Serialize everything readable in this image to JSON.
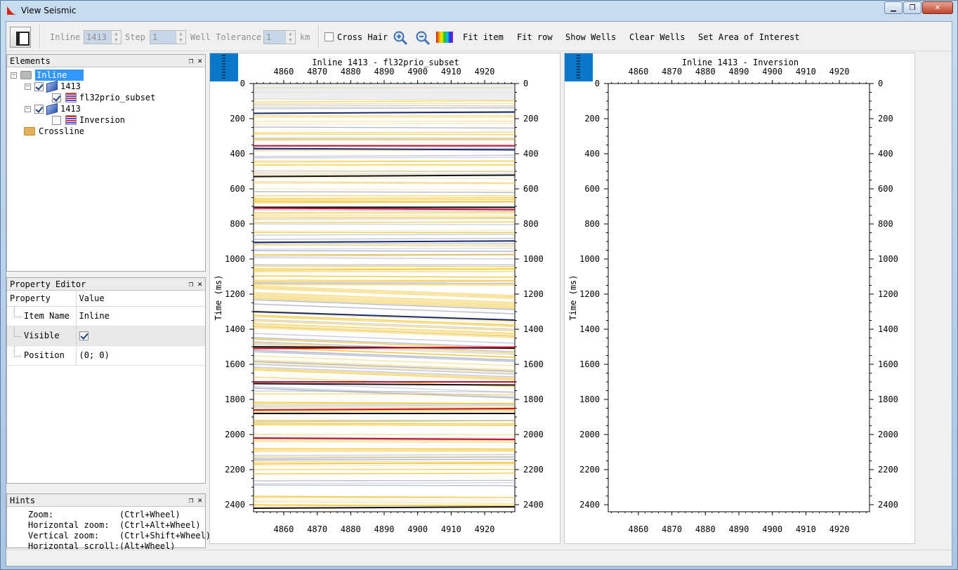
{
  "window": {
    "title": "View Seismic",
    "minimize": "▁",
    "maximize": "❐",
    "close": "✕"
  },
  "toolbar": {
    "inline_label": "Inline",
    "inline_value": "1413",
    "step_label": "Step",
    "step_value": "1",
    "well_tolerance_label": "Well Tolerance",
    "well_tolerance_value": "1",
    "unit": "km",
    "cross_hair_label": "Cross Hair",
    "cross_hair_checked": false,
    "zoom_in_icon": "zoom-in-icon",
    "zoom_out_icon": "zoom-out-icon",
    "palette_icon": "color-palette-icon",
    "fit_item": "Fit item",
    "fit_row": "Fit row",
    "show_wells": "Show Wells",
    "clear_wells": "Clear Wells",
    "set_aoi": "Set Area of Interest"
  },
  "elements_panel": {
    "title": "Elements",
    "tree": [
      {
        "label": "Inline",
        "selected": true
      },
      {
        "label": "1413",
        "checked": true
      },
      {
        "label": "fl32prio_subset",
        "checked": true
      },
      {
        "label": "1413",
        "checked": true
      },
      {
        "label": "Inversion",
        "checked": false
      },
      {
        "label": "Crossline"
      }
    ]
  },
  "property_panel": {
    "title": "Property Editor",
    "col_property": "Property",
    "col_value": "Value",
    "rows": [
      {
        "name": "Item Name",
        "value": "Inline"
      },
      {
        "name": "Visible",
        "value": ""
      },
      {
        "name": "Position",
        "value": "(0; 0)"
      }
    ]
  },
  "hints_panel": {
    "title": "Hints",
    "lines": [
      "Zoom:             (Ctrl+Wheel)",
      "Horizontal zoom:  (Ctrl+Alt+Wheel)",
      "Vertical zoom:    (Ctrl+Shift+Wheel)",
      "Horizontal scroll:(Alt+Wheel)"
    ]
  },
  "plots": [
    {
      "title": "Inline 1413 - fl32prio_subset",
      "ylabel": "Time (ms)",
      "filled": true
    },
    {
      "title": "Inline 1413 - Inversion",
      "ylabel": "Time (ms)",
      "filled": false
    }
  ],
  "axes": {
    "x_ticks": [
      "4860",
      "4870",
      "4880",
      "4890",
      "4900",
      "4910",
      "4920"
    ],
    "y_ticks": [
      "0",
      "200",
      "400",
      "600",
      "800",
      "1000",
      "1200",
      "1400",
      "1600",
      "1800",
      "2000",
      "2200",
      "2400"
    ],
    "xlim": [
      4851,
      4929
    ],
    "ylim": [
      0,
      2440
    ]
  },
  "colors": {
    "selection": "#3399ff",
    "handle": "#0a78c8",
    "positive": "#f5b800",
    "negative": "#1b2a6b",
    "strong": "#c8102e"
  }
}
